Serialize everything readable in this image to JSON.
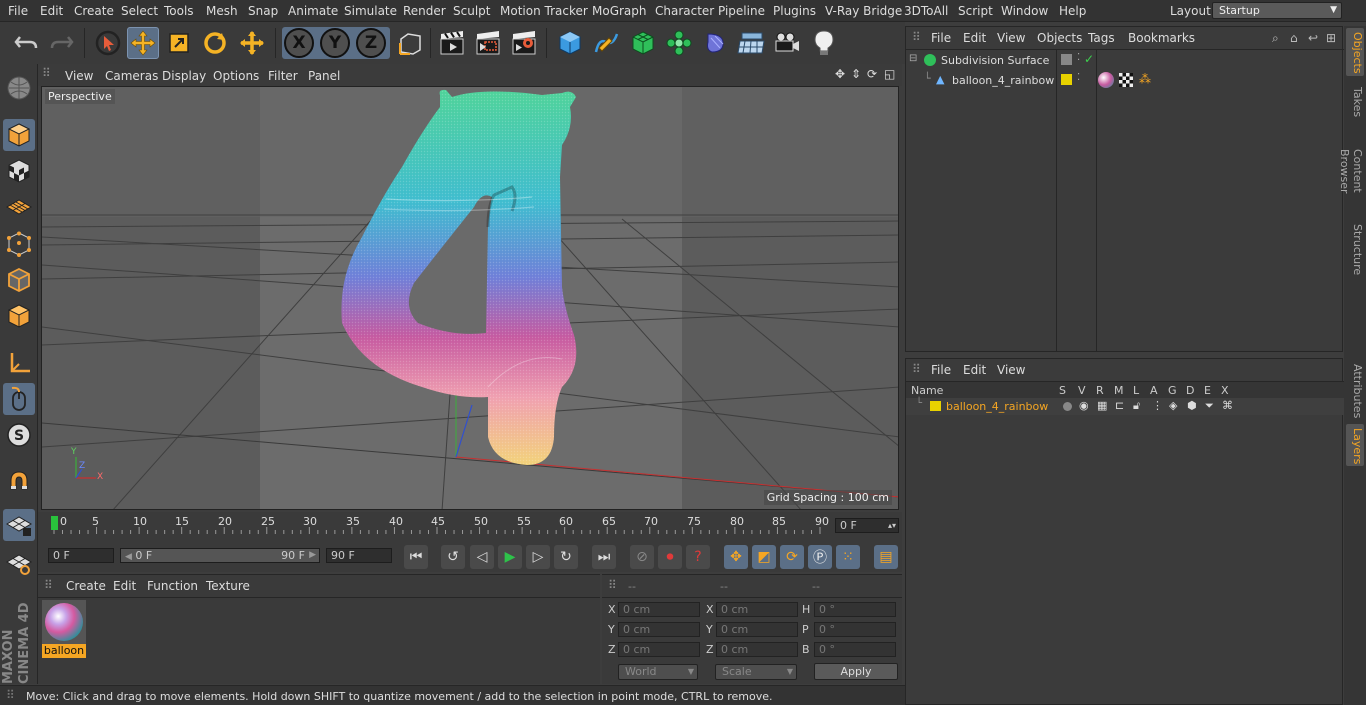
{
  "menu": {
    "items": [
      "File",
      "Edit",
      "Create",
      "Select",
      "Tools",
      "Mesh",
      "Snap",
      "Animate",
      "Simulate",
      "Render",
      "Sculpt",
      "Motion Tracker",
      "MoGraph",
      "Character",
      "Pipeline",
      "Plugins",
      "V-Ray Bridge",
      "3DToAll",
      "Script",
      "Window",
      "Help"
    ],
    "layout_label": "Layout:",
    "layout_value": "Startup"
  },
  "viewport": {
    "menu": [
      "View",
      "Cameras",
      "Display",
      "Options",
      "Filter",
      "Panel"
    ],
    "camera_label": "Perspective",
    "grid_spacing": "Grid Spacing : 100 cm",
    "axis_y": "Y",
    "axis_z": "Z",
    "axis_x": "X"
  },
  "timeline": {
    "ticks": [
      "0",
      "5",
      "10",
      "15",
      "20",
      "25",
      "30",
      "35",
      "40",
      "45",
      "50",
      "55",
      "60",
      "65",
      "70",
      "75",
      "80",
      "85",
      "90"
    ],
    "current_frame": "0 F",
    "start_frame": "0 F",
    "range_start": "0 F",
    "range_end": "90 F",
    "end_frame": "90 F"
  },
  "material_panel": {
    "menu": [
      "Create",
      "Edit",
      "Function",
      "Texture"
    ],
    "material_name": "balloon"
  },
  "coordinates": {
    "header": [
      "--",
      "--",
      "--"
    ],
    "rows": [
      {
        "l1": "X",
        "v1": "0 cm",
        "l2": "X",
        "v2": "0 cm",
        "l3": "H",
        "v3": "0 °"
      },
      {
        "l1": "Y",
        "v1": "0 cm",
        "l2": "Y",
        "v2": "0 cm",
        "l3": "P",
        "v3": "0 °"
      },
      {
        "l1": "Z",
        "v1": "0 cm",
        "l2": "Z",
        "v2": "0 cm",
        "l3": "B",
        "v3": "0 °"
      }
    ],
    "mode_world": "World",
    "mode_scale": "Scale",
    "apply": "Apply"
  },
  "status": {
    "text": "Move: Click and drag to move elements. Hold down SHIFT to quantize movement / add to the selection in point mode, CTRL to remove."
  },
  "object_manager": {
    "menu": [
      "File",
      "Edit",
      "View",
      "Objects",
      "Tags",
      "Bookmarks"
    ],
    "objects": [
      {
        "name": "Subdivision Surface"
      },
      {
        "name": "balloon_4_rainbow"
      }
    ]
  },
  "layer_manager": {
    "menu": [
      "File",
      "Edit",
      "View"
    ],
    "columns": [
      "Name",
      "S",
      "V",
      "R",
      "M",
      "L",
      "A",
      "G",
      "D",
      "E",
      "X"
    ],
    "layers": [
      {
        "name": "balloon_4_rainbow"
      }
    ]
  },
  "dock_tabs": [
    "Objects",
    "Takes",
    "Content Browser",
    "Structure",
    "Attributes",
    "Layers"
  ],
  "brand": "MAXON CINEMA 4D",
  "colors": {
    "accent": "#f5a623",
    "selected": "#5b6f87",
    "layer_yellow": "#e8d200"
  }
}
